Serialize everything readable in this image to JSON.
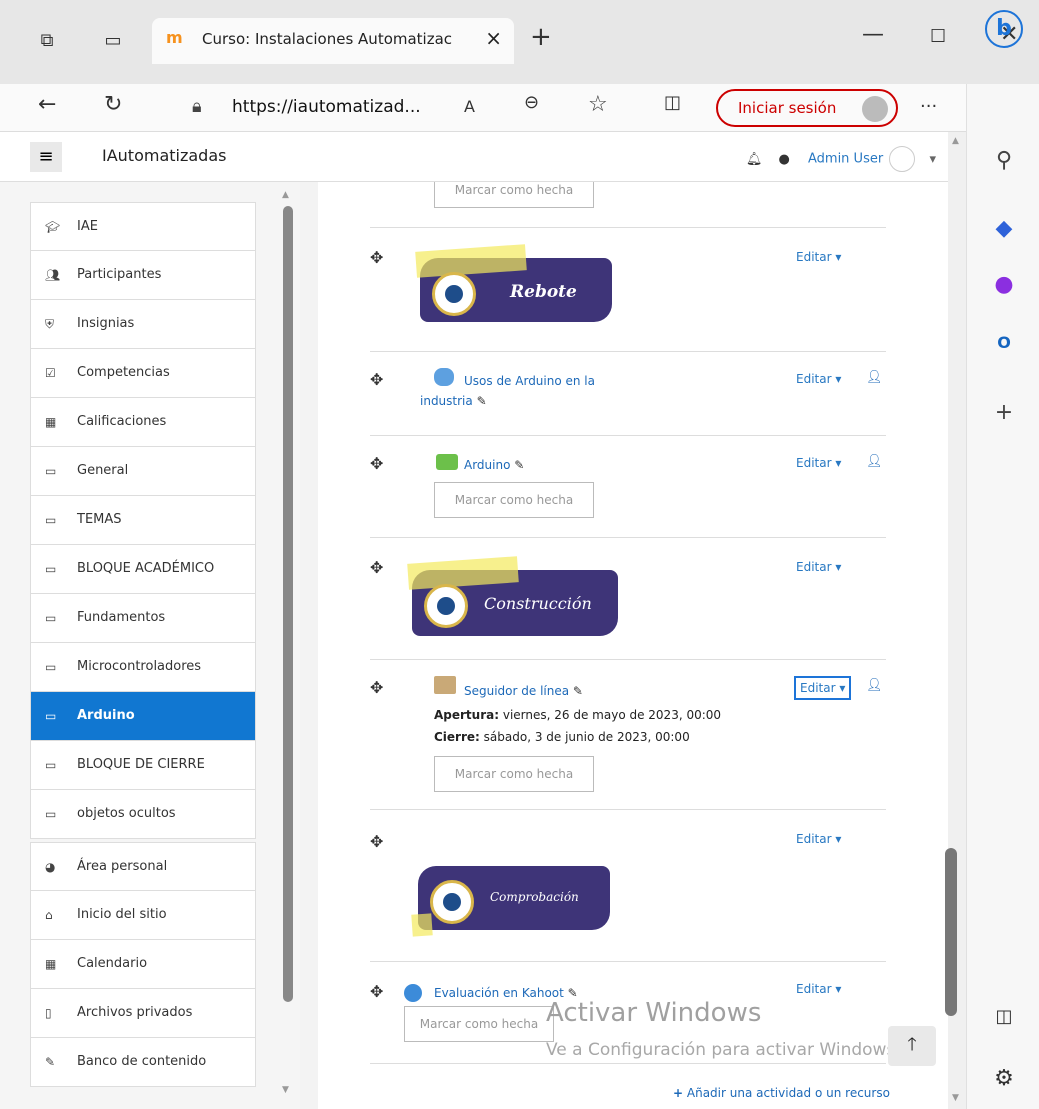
{
  "browser": {
    "tab_title": "Curso: Instalaciones Automatizac",
    "tab_close": "×",
    "new_tab": "+",
    "url": "https://iautomatizad...",
    "signin_label": "Iniciar sesión",
    "more": "···"
  },
  "header": {
    "site_name": "IAutomatizadas",
    "user_name": "Admin User"
  },
  "nav": {
    "items": [
      {
        "label": "IAE",
        "icon": "graduation-cap-icon"
      },
      {
        "label": "Participantes",
        "icon": "users-icon"
      },
      {
        "label": "Insignias",
        "icon": "shield-icon"
      },
      {
        "label": "Competencias",
        "icon": "check-square-icon"
      },
      {
        "label": "Calificaciones",
        "icon": "table-icon"
      },
      {
        "label": "General",
        "icon": "folder-icon"
      },
      {
        "label": "TEMAS",
        "icon": "folder-icon"
      },
      {
        "label": "BLOQUE ACADÉMICO",
        "icon": "folder-icon"
      },
      {
        "label": "Fundamentos",
        "icon": "folder-icon"
      },
      {
        "label": "Microcontroladores",
        "icon": "folder-icon"
      },
      {
        "label": "Arduino",
        "icon": "folder-icon",
        "active": true
      },
      {
        "label": "BLOQUE DE CIERRE",
        "icon": "folder-icon"
      },
      {
        "label": "objetos ocultos",
        "icon": "folder-icon"
      },
      {
        "label": "Área personal",
        "icon": "dashboard-icon"
      },
      {
        "label": "Inicio del sitio",
        "icon": "home-icon"
      },
      {
        "label": "Calendario",
        "icon": "calendar-icon"
      },
      {
        "label": "Archivos privados",
        "icon": "file-icon"
      },
      {
        "label": "Banco de contenido",
        "icon": "pen-icon"
      }
    ]
  },
  "content": {
    "mark_done": "Marcar como hecha",
    "edit": "Editar",
    "banner_rebote": "Rebote",
    "banner_construccion": "Construcción",
    "banner_comprobacion": "Comprobación",
    "forum_usos": "Usos de Arduino en la",
    "forum_usos_2": "industria",
    "chat_arduino": "Arduino",
    "assign_seguidor": "Seguidor de línea",
    "apertura_label": "Apertura:",
    "apertura_value": "viernes, 26 de mayo de 2023, 00:00",
    "cierre_label": "Cierre:",
    "cierre_value": "sábado, 3 de junio de 2023, 00:00",
    "kahoot": "Evaluación en Kahoot",
    "add_activity": "Añadir una actividad o un recurso"
  },
  "watermark": {
    "line1": "Activar Windows",
    "line2": "Ve a Configuración para activar Windows."
  }
}
